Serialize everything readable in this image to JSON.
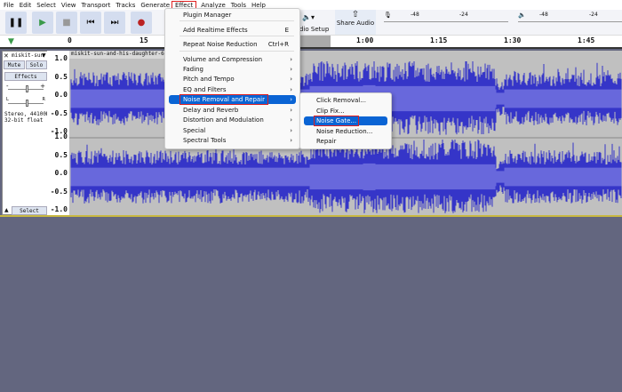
{
  "menubar": [
    "File",
    "Edit",
    "Select",
    "View",
    "Transport",
    "Tracks",
    "Generate",
    "Effect",
    "Analyze",
    "Tools",
    "Help"
  ],
  "toolbar": {
    "pause": "❚❚",
    "play": "▶",
    "stop": "■",
    "skip_start": "⏮",
    "skip_end": "⏭",
    "record": "●",
    "audio_setup": "dio Setup",
    "share_audio": "Share Audio",
    "meter_ticks": [
      "-48",
      "-24"
    ]
  },
  "ruler": {
    "labels": [
      "0",
      "15",
      "1:00",
      "1:15",
      "1:30",
      "1:45"
    ]
  },
  "track": {
    "name": "miskit-sun",
    "clip_name": "miskit-sun-and-his-daughter-680",
    "mute": "Mute",
    "solo": "Solo",
    "effects": "Effects",
    "format_line1": "Stereo, 44100Hz",
    "format_line2": "32-bit float",
    "select": "Select",
    "gain_minus": "-",
    "gain_plus": "+",
    "pan_l": "L",
    "pan_r": "R",
    "scale": [
      "1.0",
      "0.5",
      "0.0",
      "-0.5",
      "-1.0"
    ]
  },
  "effect_menu": {
    "items": [
      {
        "label": "Plugin Manager"
      },
      {
        "label": "Add Realtime Effects",
        "shortcut": "E"
      },
      {
        "label": "Repeat Noise Reduction",
        "shortcut": "Ctrl+R"
      },
      {
        "label": "Volume and Compression"
      },
      {
        "label": "Fading"
      },
      {
        "label": "Pitch and Tempo"
      },
      {
        "label": "EQ and Filters"
      },
      {
        "label": "Noise Removal and Repair"
      },
      {
        "label": "Delay and Reverb"
      },
      {
        "label": "Distortion and Modulation"
      },
      {
        "label": "Special"
      },
      {
        "label": "Spectral Tools"
      }
    ],
    "arrow": "›"
  },
  "submenu": {
    "items": [
      "Click Removal...",
      "Clip Fix...",
      "Noise Gate...",
      "Noise Reduction...",
      "Repair"
    ]
  },
  "colors": {
    "waveform": "#3535c8",
    "waveform_rms": "#6868dc",
    "highlight": "#0a64d4",
    "annotation": "#e02020",
    "background": "#63667f"
  }
}
